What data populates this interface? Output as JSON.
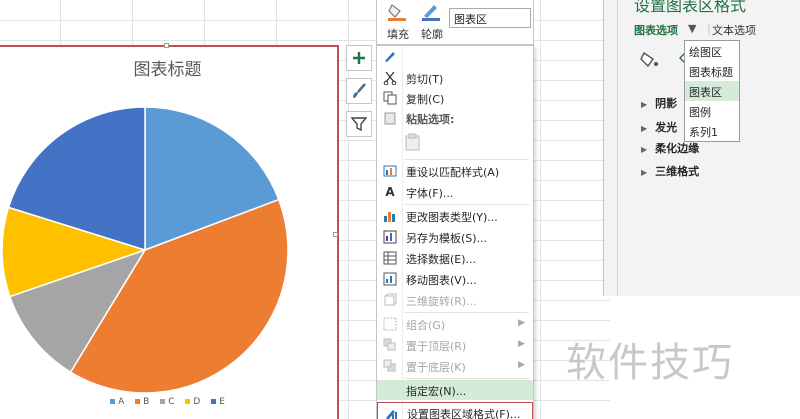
{
  "chart": {
    "title": "图表标题",
    "legend": [
      {
        "label": "A",
        "color": "#5b9bd5"
      },
      {
        "label": "B",
        "color": "#ed7d31"
      },
      {
        "label": "C",
        "color": "#a5a5a5"
      },
      {
        "label": "D",
        "color": "#ffc000"
      },
      {
        "label": "E",
        "color": "#4472c4"
      }
    ]
  },
  "chart_data": {
    "type": "pie",
    "title": "图表标题",
    "categories": [
      "A",
      "B",
      "C",
      "D",
      "E"
    ],
    "values": [
      21,
      43,
      12,
      11,
      22
    ],
    "colors": [
      "#5b9bd5",
      "#ed7d31",
      "#a5a5a5",
      "#ffc000",
      "#4472c4"
    ],
    "legend_position": "bottom"
  },
  "side_buttons": [
    {
      "name": "chart-elements-button",
      "glyph": "+"
    },
    {
      "name": "chart-styles-button",
      "glyph": "brush"
    },
    {
      "name": "chart-filters-button",
      "glyph": "filter"
    }
  ],
  "minibar": {
    "fill_label": "填充",
    "outline_label": "轮廓",
    "element_select_value": "图表区"
  },
  "context_menu": {
    "cut": "剪切(T)",
    "copy": "复制(C)",
    "paste_options": "粘贴选项:",
    "reset_style": "重设以匹配样式(A)",
    "font": "字体(F)...",
    "change_type": "更改图表类型(Y)...",
    "save_template": "另存为模板(S)...",
    "select_data": "选择数据(E)...",
    "move_chart": "移动图表(V)...",
    "rotate_3d": "三维旋转(R)...",
    "group": "组合(G)",
    "bring_front": "置于顶层(R)",
    "send_back": "置于底层(K)",
    "assign_macro": "指定宏(N)...",
    "format_chart_area": "设置图表区域格式(F)..."
  },
  "pane": {
    "title": "设置图表区格式",
    "tab_chart_options": "图表选项",
    "tab_text_options": "文本选项",
    "sections": [
      "阴影",
      "发光",
      "柔化边缘",
      "三维格式"
    ],
    "accent_color": "#217346"
  },
  "dropdown": {
    "items": [
      "绘图区",
      "图表标题",
      "图表区",
      "图例",
      "系列1"
    ],
    "selected_index": 2
  },
  "watermark": "软件技巧"
}
